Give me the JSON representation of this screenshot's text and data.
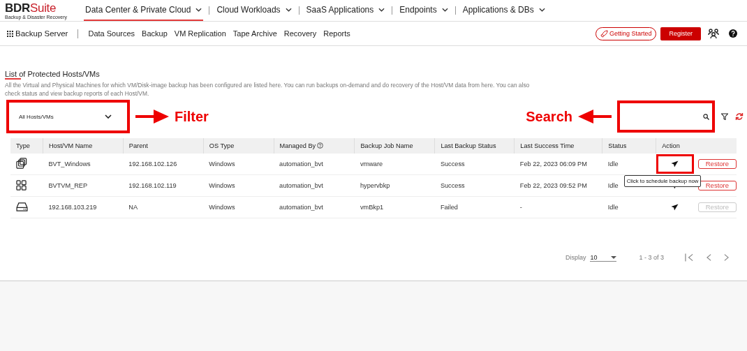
{
  "logo": {
    "name": "BDR",
    "name_accent": "Suite",
    "tagline": "Backup & Disaster Recovery"
  },
  "top_nav": [
    {
      "label": "Data Center & Private Cloud",
      "selected": true
    },
    {
      "label": "Cloud Workloads",
      "selected": false
    },
    {
      "label": "SaaS Applications",
      "selected": false
    },
    {
      "label": "Endpoints",
      "selected": false
    },
    {
      "label": "Applications & DBs",
      "selected": false
    }
  ],
  "sub_nav": {
    "server": "Backup Server",
    "items": [
      "Data Sources",
      "Backup",
      "VM Replication",
      "Tape Archive",
      "Recovery",
      "Reports"
    ],
    "getting_started": "Getting Started",
    "register": "Register"
  },
  "page": {
    "title": "List of Protected Hosts/VMs",
    "description": "All the Virtual and Physical Machines for which VM/Disk-image backup has been configured are listed here. You can run backups on-demand and do recovery of the Host/VM data from here. You can also check status and view backup reports of each Host/VM."
  },
  "filter": {
    "value": "All Hosts/VMs",
    "annotation": "Filter"
  },
  "search": {
    "annotation": "Search"
  },
  "table": {
    "columns": [
      "Type",
      "Host/VM Name",
      "Parent",
      "OS Type",
      "Managed By",
      "Backup Job Name",
      "Last Backup Status",
      "Last Success Time",
      "Status",
      "Action"
    ],
    "rows": [
      {
        "kind": "vm",
        "name": "BVT_Windows",
        "parent": "192.168.102.126",
        "os": "Windows",
        "managed_by": "automation_bvt",
        "job": "vmware",
        "last_status": "Success",
        "last_success": "Feb 22, 2023 06:09 PM",
        "status": "Idle",
        "restore": "Restore",
        "restore_disabled": false,
        "highlighted": true,
        "tooltip": "Click to schedule backup now"
      },
      {
        "kind": "hyperv",
        "name": "BVTVM_REP",
        "parent": "192.168.102.119",
        "os": "Windows",
        "managed_by": "automation_bvt",
        "job": "hypervbkp",
        "last_status": "Success",
        "last_success": "Feb 22, 2023 09:52 PM",
        "status": "Idle",
        "restore": "Restore",
        "restore_disabled": false,
        "highlighted": false
      },
      {
        "kind": "physical",
        "name": "192.168.103.219",
        "parent": "NA",
        "os": "Windows",
        "managed_by": "automation_bvt",
        "job": "vmBkp1",
        "last_status": "Failed",
        "last_success": "-",
        "status": "Idle",
        "restore": "Restore",
        "restore_disabled": true,
        "highlighted": false
      }
    ]
  },
  "pagination": {
    "label": "Display",
    "page_size": "10",
    "range": "1 - 3 of 3"
  }
}
